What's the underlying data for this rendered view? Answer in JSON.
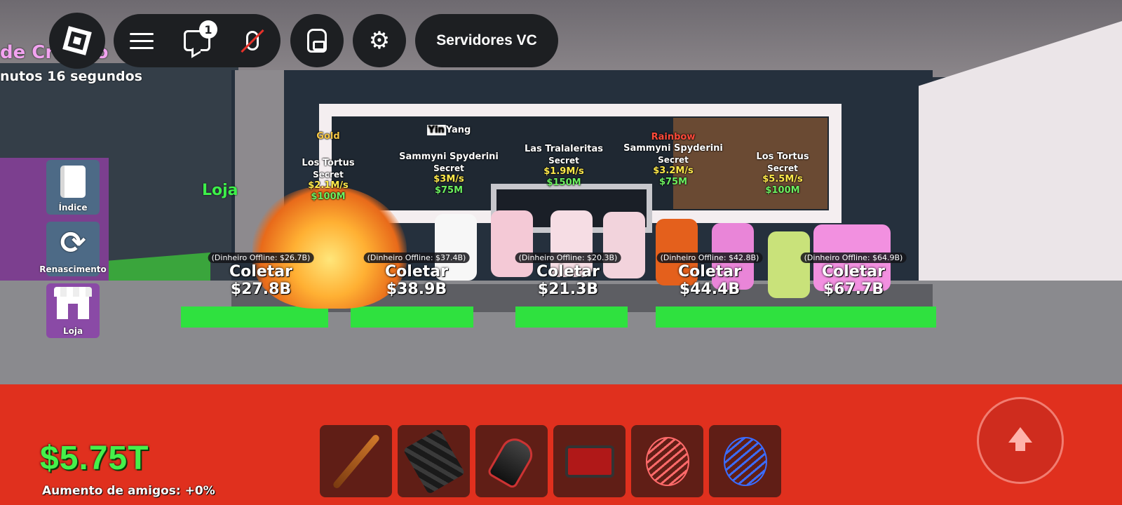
{
  "topbar": {
    "chat_badge_count": "1",
    "servers_button_label": "Servidores VC",
    "icons": [
      "roblox-logo-icon",
      "menu-icon",
      "chat-icon",
      "mic-muted-icon",
      "backpack-icon",
      "gear-icon"
    ]
  },
  "event": {
    "title_partial": "de Criação",
    "timer_partial": "nutos 16 segundos"
  },
  "side_menu": {
    "index_label": "Índice",
    "rebirth_label": "Renascimento",
    "shop_label": "Loja"
  },
  "world": {
    "shop_sign": "Loja"
  },
  "brainrots": [
    {
      "mutation": "Gold",
      "name": "Los Tortus",
      "rarity": "Secret",
      "rate": "$2.1M/s",
      "price": "$100M"
    },
    {
      "mutation_a": "Yin",
      "mutation_b": "Yang",
      "name": "Sammyni Spyderini",
      "rarity": "Secret",
      "rate": "$3M/s",
      "price": "$75M"
    },
    {
      "mutation": "",
      "name": "Las Tralaleritas",
      "rarity": "Secret",
      "rate": "$1.9M/s",
      "price": "$150M"
    },
    {
      "mutation": "Rainbow",
      "name": "Sammyni Spyderini",
      "rarity": "Secret",
      "rate": "$3.2M/s",
      "price": "$75M"
    },
    {
      "mutation": "",
      "name": "Los Tortus",
      "rarity": "Secret",
      "rate": "$5.5M/s",
      "price": "$100M"
    }
  ],
  "collectors": [
    {
      "offline": "(Dinheiro Offline: $26.7B)",
      "label": "Coletar",
      "amount": "$27.8B"
    },
    {
      "offline": "(Dinheiro Offline: $37.4B)",
      "label": "Coletar",
      "amount": "$38.9B"
    },
    {
      "offline": "(Dinheiro Offline: $20.3B)",
      "label": "Coletar",
      "amount": "$21.3B"
    },
    {
      "offline": "(Dinheiro Offline: $42.8B)",
      "label": "Coletar",
      "amount": "$44.4B"
    },
    {
      "offline": "(Dinheiro Offline: $64.9B)",
      "label": "Coletar",
      "amount": "$67.7B"
    }
  ],
  "hud": {
    "money": "$5.75T",
    "friends_boost": "Aumento de amigos: +0%"
  },
  "hotbar": [
    {
      "icon": "bat-icon"
    },
    {
      "icon": "cloak-icon"
    },
    {
      "icon": "grapple-gadget-icon"
    },
    {
      "icon": "boombox-icon"
    },
    {
      "icon": "red-coil-icon"
    },
    {
      "icon": "blue-coil-icon"
    }
  ],
  "colors": {
    "money_green": "#45f04a",
    "collect_pad": "#2fe13f",
    "red_floor": "#e0301e",
    "topbar_bg": "#1d1f22",
    "rate_yellow": "#ffe94a",
    "price_green": "#6cf060"
  }
}
